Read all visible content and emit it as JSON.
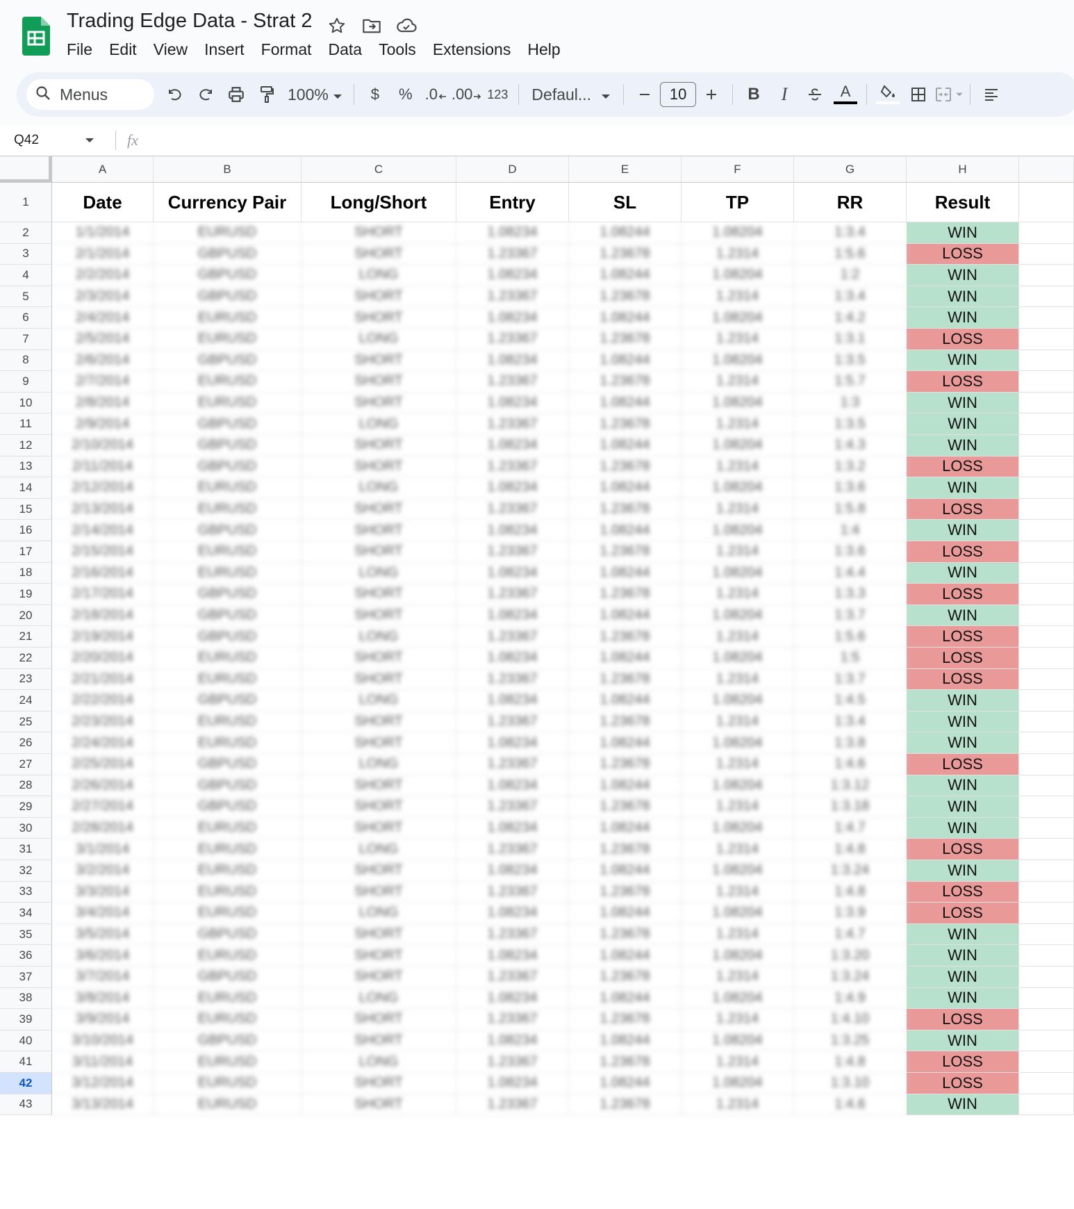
{
  "document": {
    "title": "Trading Edge Data - Strat 2",
    "icons": [
      "star-icon",
      "move-to-folder-icon",
      "cloud-saved-icon"
    ]
  },
  "menu": [
    "File",
    "Edit",
    "View",
    "Insert",
    "Format",
    "Data",
    "Tools",
    "Extensions",
    "Help"
  ],
  "toolbar": {
    "search_label": "Menus",
    "zoom": "100%",
    "currency": "$",
    "percent": "%",
    "decrease_decimal": ".0",
    "increase_decimal": ".00",
    "number_format": "123",
    "font": "Defaul...",
    "font_size": "10",
    "bold": "B",
    "italic": "I",
    "text_color": "A"
  },
  "formula_bar": {
    "cell_ref": "Q42",
    "fx_label": "fx",
    "value": ""
  },
  "colors": {
    "win": "#b7e1cd",
    "loss": "#ea9999",
    "active_row": "#d3e3fd",
    "brand": "#0f9d58"
  },
  "sheet": {
    "column_letters": [
      "A",
      "B",
      "C",
      "D",
      "E",
      "F",
      "G",
      "H"
    ],
    "headers": [
      "Date",
      "Currency Pair",
      "Long/Short",
      "Entry",
      "SL",
      "TP",
      "RR",
      "Result"
    ],
    "rows": [
      [
        "1/1/2014",
        "EURUSD",
        "SHORT",
        "1.08234",
        "1.08244",
        "1.08204",
        "1:3.4",
        "WIN"
      ],
      [
        "2/1/2014",
        "GBPUSD",
        "SHORT",
        "1.23367",
        "1.23678",
        "1.2314",
        "1:5.6",
        "LOSS"
      ],
      [
        "2/2/2014",
        "GBPUSD",
        "LONG",
        "1.08234",
        "1.08244",
        "1.08204",
        "1:2",
        "WIN"
      ],
      [
        "2/3/2014",
        "GBPUSD",
        "SHORT",
        "1.23367",
        "1.23678",
        "1.2314",
        "1:3.4",
        "WIN"
      ],
      [
        "2/4/2014",
        "EURUSD",
        "SHORT",
        "1.08234",
        "1.08244",
        "1.08204",
        "1:4.2",
        "WIN"
      ],
      [
        "2/5/2014",
        "EURUSD",
        "LONG",
        "1.23367",
        "1.23678",
        "1.2314",
        "1:3.1",
        "LOSS"
      ],
      [
        "2/6/2014",
        "GBPUSD",
        "SHORT",
        "1.08234",
        "1.08244",
        "1.08204",
        "1:3.5",
        "WIN"
      ],
      [
        "2/7/2014",
        "EURUSD",
        "SHORT",
        "1.23367",
        "1.23678",
        "1.2314",
        "1:5.7",
        "LOSS"
      ],
      [
        "2/8/2014",
        "EURUSD",
        "SHORT",
        "1.08234",
        "1.08244",
        "1.08204",
        "1:3",
        "WIN"
      ],
      [
        "2/9/2014",
        "GBPUSD",
        "LONG",
        "1.23367",
        "1.23678",
        "1.2314",
        "1:3.5",
        "WIN"
      ],
      [
        "2/10/2014",
        "GBPUSD",
        "SHORT",
        "1.08234",
        "1.08244",
        "1.08204",
        "1:4.3",
        "WIN"
      ],
      [
        "2/11/2014",
        "GBPUSD",
        "SHORT",
        "1.23367",
        "1.23678",
        "1.2314",
        "1:3.2",
        "LOSS"
      ],
      [
        "2/12/2014",
        "EURUSD",
        "LONG",
        "1.08234",
        "1.08244",
        "1.08204",
        "1:3.6",
        "WIN"
      ],
      [
        "2/13/2014",
        "EURUSD",
        "SHORT",
        "1.23367",
        "1.23678",
        "1.2314",
        "1:5.8",
        "LOSS"
      ],
      [
        "2/14/2014",
        "GBPUSD",
        "SHORT",
        "1.08234",
        "1.08244",
        "1.08204",
        "1:4",
        "WIN"
      ],
      [
        "2/15/2014",
        "EURUSD",
        "SHORT",
        "1.23367",
        "1.23678",
        "1.2314",
        "1:3.6",
        "LOSS"
      ],
      [
        "2/16/2014",
        "EURUSD",
        "LONG",
        "1.08234",
        "1.08244",
        "1.08204",
        "1:4.4",
        "WIN"
      ],
      [
        "2/17/2014",
        "GBPUSD",
        "SHORT",
        "1.23367",
        "1.23678",
        "1.2314",
        "1:3.3",
        "LOSS"
      ],
      [
        "2/18/2014",
        "GBPUSD",
        "SHORT",
        "1.08234",
        "1.08244",
        "1.08204",
        "1:3.7",
        "WIN"
      ],
      [
        "2/19/2014",
        "GBPUSD",
        "LONG",
        "1.23367",
        "1.23678",
        "1.2314",
        "1:5.6",
        "LOSS"
      ],
      [
        "2/20/2014",
        "EURUSD",
        "SHORT",
        "1.08234",
        "1.08244",
        "1.08204",
        "1:5",
        "LOSS"
      ],
      [
        "2/21/2014",
        "EURUSD",
        "SHORT",
        "1.23367",
        "1.23678",
        "1.2314",
        "1:3.7",
        "LOSS"
      ],
      [
        "2/22/2014",
        "GBPUSD",
        "LONG",
        "1.08234",
        "1.08244",
        "1.08204",
        "1:4.5",
        "WIN"
      ],
      [
        "2/23/2014",
        "EURUSD",
        "SHORT",
        "1.23367",
        "1.23678",
        "1.2314",
        "1:3.4",
        "WIN"
      ],
      [
        "2/24/2014",
        "EURUSD",
        "SHORT",
        "1.08234",
        "1.08244",
        "1.08204",
        "1:3.8",
        "WIN"
      ],
      [
        "2/25/2014",
        "GBPUSD",
        "LONG",
        "1.23367",
        "1.23678",
        "1.2314",
        "1:4.6",
        "LOSS"
      ],
      [
        "2/26/2014",
        "GBPUSD",
        "SHORT",
        "1.08234",
        "1.08244",
        "1.08204",
        "1:3.12",
        "WIN"
      ],
      [
        "2/27/2014",
        "GBPUSD",
        "SHORT",
        "1.23367",
        "1.23678",
        "1.2314",
        "1:3.18",
        "WIN"
      ],
      [
        "2/28/2014",
        "EURUSD",
        "SHORT",
        "1.08234",
        "1.08244",
        "1.08204",
        "1:4.7",
        "WIN"
      ],
      [
        "3/1/2014",
        "EURUSD",
        "LONG",
        "1.23367",
        "1.23678",
        "1.2314",
        "1:4.8",
        "LOSS"
      ],
      [
        "3/2/2014",
        "EURUSD",
        "SHORT",
        "1.08234",
        "1.08244",
        "1.08204",
        "1:3.24",
        "WIN"
      ],
      [
        "3/3/2014",
        "EURUSD",
        "SHORT",
        "1.23367",
        "1.23678",
        "1.2314",
        "1:4.8",
        "LOSS"
      ],
      [
        "3/4/2014",
        "EURUSD",
        "LONG",
        "1.08234",
        "1.08244",
        "1.08204",
        "1:3.9",
        "LOSS"
      ],
      [
        "3/5/2014",
        "GBPUSD",
        "SHORT",
        "1.23367",
        "1.23678",
        "1.2314",
        "1:4.7",
        "WIN"
      ],
      [
        "3/6/2014",
        "EURUSD",
        "SHORT",
        "1.08234",
        "1.08244",
        "1.08204",
        "1:3.20",
        "WIN"
      ],
      [
        "3/7/2014",
        "GBPUSD",
        "SHORT",
        "1.23367",
        "1.23678",
        "1.2314",
        "1:3.24",
        "WIN"
      ],
      [
        "3/8/2014",
        "EURUSD",
        "LONG",
        "1.08234",
        "1.08244",
        "1.08204",
        "1:4.9",
        "WIN"
      ],
      [
        "3/9/2014",
        "EURUSD",
        "SHORT",
        "1.23367",
        "1.23678",
        "1.2314",
        "1:4.10",
        "LOSS"
      ],
      [
        "3/10/2014",
        "GBPUSD",
        "SHORT",
        "1.08234",
        "1.08244",
        "1.08204",
        "1:3.25",
        "WIN"
      ],
      [
        "3/11/2014",
        "EURUSD",
        "LONG",
        "1.23367",
        "1.23678",
        "1.2314",
        "1:4.8",
        "LOSS"
      ],
      [
        "3/12/2014",
        "EURUSD",
        "SHORT",
        "1.08234",
        "1.08244",
        "1.08204",
        "1:3.10",
        "LOSS"
      ],
      [
        "3/13/2014",
        "EURUSD",
        "SHORT",
        "1.23367",
        "1.23678",
        "1.2314",
        "1:4.6",
        "WIN"
      ]
    ],
    "first_row_number": 2,
    "active_row": 42
  }
}
